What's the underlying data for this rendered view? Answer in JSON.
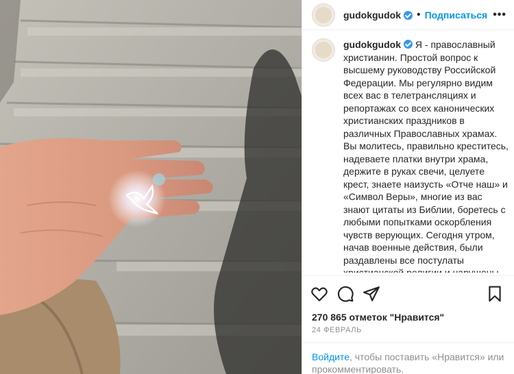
{
  "post": {
    "username": "gudokgudok",
    "follow_label": "Подписаться",
    "header_separator": "•",
    "more_label": "•••",
    "caption": "Я - православный христианин. Простой вопрос к высшему руководству Российской Федерации. Мы регулярно видим всех вас в телетрансляциях и репортажах со всех канонических христианских праздников в различных Православных храмах. Вы молитесь, правильно креститесь, надеваете платки внутри храма, держите в руках свечи, целуете крест, знаете наизусть «Отче наш» и «Символ Веры», многие из вас знают цитаты из Библии, боретесь с любыми попытками оскорбления чувств верующих. Сегодня утром, начав военные действия, были раздавлены все постулаты христианской религии и нарушены заповеди, растоптана главная христианская истина всепрощения.",
    "likes": "270 865 отметок \"Нравится\"",
    "date": "24 февраль"
  },
  "login_prompt": {
    "link": "Войдите",
    "text": ", чтобы поставить «Нравится» или прокомментировать."
  },
  "icons": {
    "verified": "verified-badge-icon",
    "like": "heart-icon",
    "comment": "comment-icon",
    "share": "send-icon",
    "save": "bookmark-icon"
  },
  "colors": {
    "accent": "#0095f6",
    "verified": "#3897f0",
    "muted": "#8e8e8e"
  }
}
